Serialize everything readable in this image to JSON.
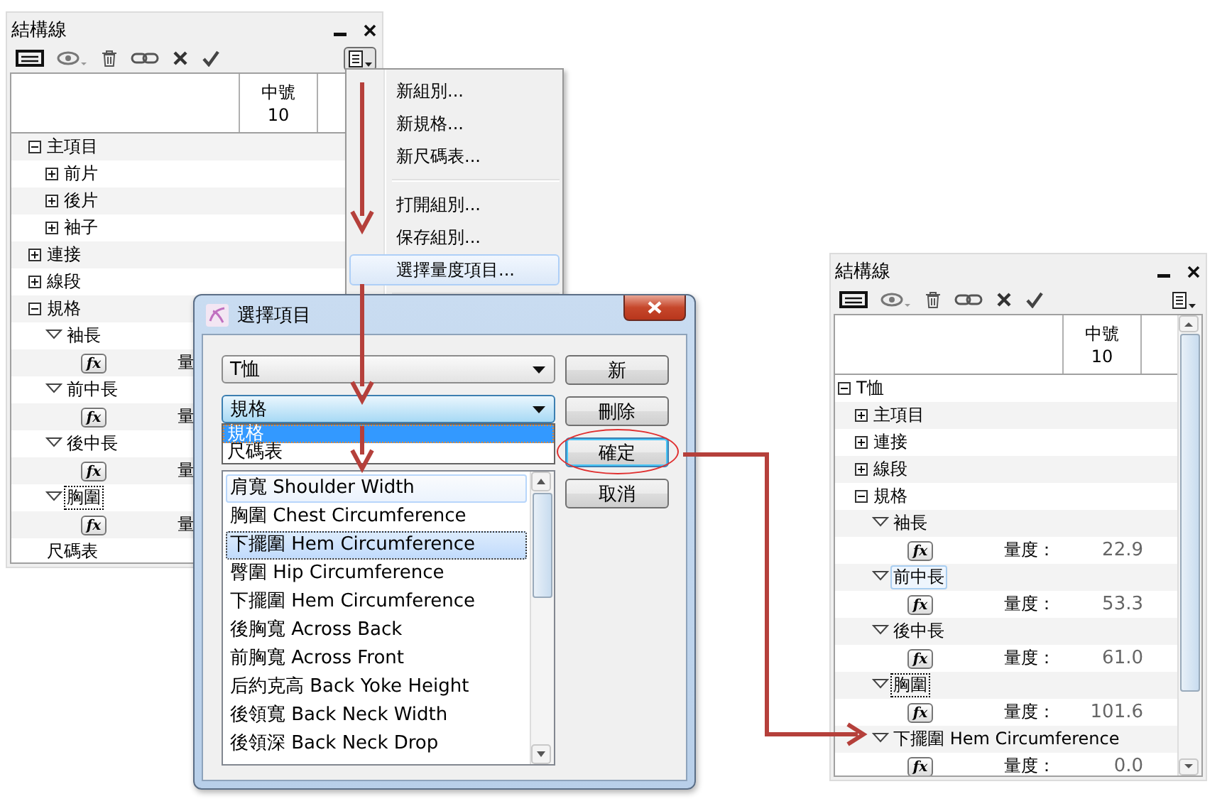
{
  "left_panel": {
    "title": "結構線",
    "menu_open": true,
    "columns": [
      {
        "name": "中號",
        "size": "10"
      }
    ],
    "tree": [
      {
        "kind": "group",
        "label": "主項目",
        "expanded": true,
        "children": [
          {
            "kind": "group",
            "label": "前片",
            "expanded": false
          },
          {
            "kind": "group",
            "label": "後片",
            "expanded": false
          },
          {
            "kind": "group",
            "label": "袖子",
            "expanded": false
          }
        ]
      },
      {
        "kind": "group",
        "label": "連接",
        "expanded": false
      },
      {
        "kind": "group",
        "label": "線段",
        "expanded": false
      },
      {
        "kind": "group",
        "label": "規格",
        "expanded": true,
        "children": [
          {
            "kind": "measure",
            "label": "袖長",
            "expanded": true,
            "focused": false,
            "hovered": false,
            "children": [
              {
                "kind": "formula",
                "button": "fx",
                "label": "量"
              }
            ]
          },
          {
            "kind": "measure",
            "label": "前中長",
            "expanded": true,
            "focused": false,
            "hovered": false,
            "children": [
              {
                "kind": "formula",
                "button": "fx",
                "label": "量"
              }
            ]
          },
          {
            "kind": "measure",
            "label": "後中長",
            "expanded": true,
            "focused": false,
            "hovered": false,
            "children": [
              {
                "kind": "formula",
                "button": "fx",
                "label": "量"
              }
            ]
          },
          {
            "kind": "measure",
            "label": "胸圍",
            "expanded": true,
            "focused": true,
            "hovered": false,
            "children": [
              {
                "kind": "formula",
                "button": "fx",
                "label": "量"
              }
            ]
          }
        ]
      },
      {
        "kind": "table",
        "label": "尺碼表"
      }
    ]
  },
  "menu": {
    "items": [
      {
        "kind": "item",
        "label": "新組別...",
        "highlighted": false
      },
      {
        "kind": "item",
        "label": "新規格...",
        "highlighted": false
      },
      {
        "kind": "item",
        "label": "新尺碼表...",
        "highlighted": false
      },
      {
        "kind": "separator"
      },
      {
        "kind": "item",
        "label": "打開組別...",
        "highlighted": false
      },
      {
        "kind": "item",
        "label": "保存組別...",
        "highlighted": false
      },
      {
        "kind": "item",
        "label": "選擇量度項目...",
        "highlighted": true
      },
      {
        "kind": "separator"
      }
    ]
  },
  "dialog": {
    "title": "選擇項目",
    "garment": {
      "value": "T恤"
    },
    "category": {
      "value": "規格",
      "expanded": true,
      "options": [
        {
          "label": "規格",
          "selected": true
        },
        {
          "label": "尺碼表",
          "selected": false
        }
      ]
    },
    "buttons": [
      {
        "label": "新",
        "default": false,
        "annotated": false
      },
      {
        "label": "刪除",
        "default": false,
        "annotated": false
      },
      {
        "label": "確定",
        "default": true,
        "annotated": true
      },
      {
        "label": "取消",
        "default": false,
        "annotated": false
      }
    ],
    "items": [
      {
        "label": "肩寬 Shoulder Width",
        "selected": false,
        "hovered": true
      },
      {
        "label": "胸圍 Chest Circumference",
        "selected": false,
        "hovered": false
      },
      {
        "label": "下擺圍 Hem Circumference",
        "selected": true,
        "hovered": false
      },
      {
        "label": "臀圍 Hip Circumference",
        "selected": false,
        "hovered": false
      },
      {
        "label": "下擺圍 Hem Circumference",
        "selected": false,
        "hovered": false
      },
      {
        "label": "後胸寬 Across Back",
        "selected": false,
        "hovered": false
      },
      {
        "label": "前胸寬 Across Front",
        "selected": false,
        "hovered": false
      },
      {
        "label": "后約克高 Back Yoke Height",
        "selected": false,
        "hovered": false
      },
      {
        "label": "後領寬 Back Neck Width",
        "selected": false,
        "hovered": false
      },
      {
        "label": "後領深 Back Neck Drop",
        "selected": false,
        "hovered": false
      }
    ]
  },
  "right_panel": {
    "title": "結構線",
    "menu_open": false,
    "columns": [
      {
        "name": "中號",
        "size": "10"
      }
    ],
    "tree": [
      {
        "kind": "group",
        "label": "T恤",
        "expanded": true,
        "children": [
          {
            "kind": "group",
            "label": "主項目",
            "expanded": false
          },
          {
            "kind": "group",
            "label": "連接",
            "expanded": false
          },
          {
            "kind": "group",
            "label": "線段",
            "expanded": false
          },
          {
            "kind": "group",
            "label": "規格",
            "expanded": true,
            "children": [
              {
                "kind": "measure",
                "label": "袖長",
                "expanded": true,
                "focused": false,
                "hovered": false,
                "children": [
                  {
                    "kind": "formula",
                    "button": "fx",
                    "label": "量度：",
                    "value": "22.9"
                  }
                ]
              },
              {
                "kind": "measure",
                "label": "前中長",
                "expanded": true,
                "focused": false,
                "hovered": true,
                "children": [
                  {
                    "kind": "formula",
                    "button": "fx",
                    "label": "量度：",
                    "value": "53.3"
                  }
                ]
              },
              {
                "kind": "measure",
                "label": "後中長",
                "expanded": true,
                "focused": false,
                "hovered": false,
                "children": [
                  {
                    "kind": "formula",
                    "button": "fx",
                    "label": "量度：",
                    "value": "61.0"
                  }
                ]
              },
              {
                "kind": "measure",
                "label": "胸圍",
                "expanded": true,
                "focused": true,
                "hovered": false,
                "children": [
                  {
                    "kind": "formula",
                    "button": "fx",
                    "label": "量度：",
                    "value": "101.6"
                  }
                ]
              },
              {
                "kind": "measure",
                "label": "下擺圍 Hem Circumference",
                "expanded": true,
                "focused": false,
                "hovered": false,
                "children": [
                  {
                    "kind": "formula",
                    "button": "fx",
                    "label": "量度：",
                    "value": "0.0"
                  }
                ]
              }
            ]
          }
        ]
      }
    ]
  }
}
